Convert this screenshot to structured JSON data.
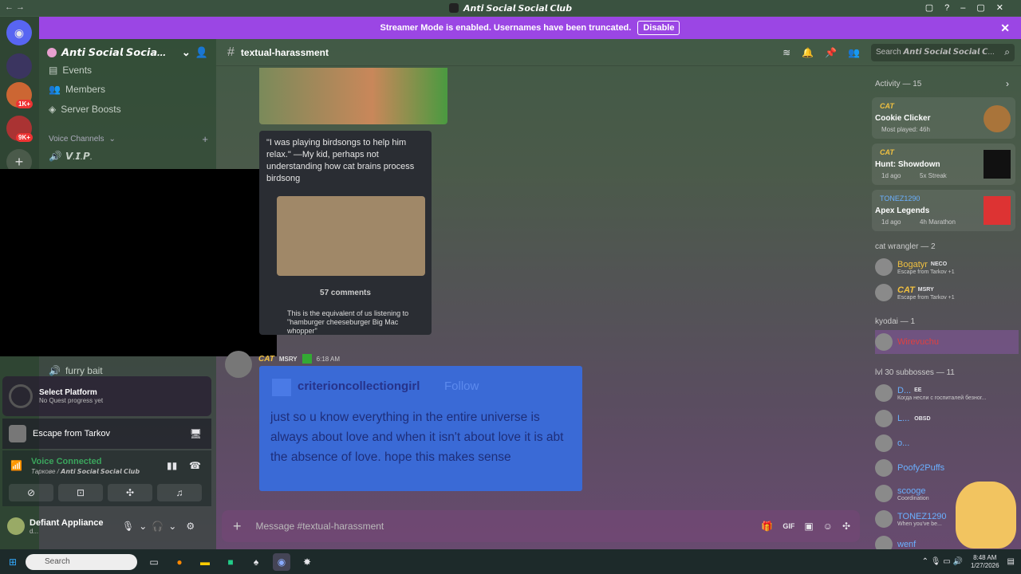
{
  "window": {
    "title": "𝘼𝙣𝙩𝙞 𝙎𝙤𝙘𝙞𝙖𝙡 𝙎𝙤𝙘𝙞𝙖𝙡 𝘾𝙡𝙪𝙗"
  },
  "banner": {
    "text": "Streamer Mode is enabled. Usernames have been truncated.",
    "button": "Disable"
  },
  "server": {
    "name": "𝘼𝙣𝙩𝙞 𝙎𝙤𝙘𝙞𝙖𝙡 𝙎𝙤𝙘𝙞𝙖..."
  },
  "sidebar": {
    "items": [
      {
        "label": "Events"
      },
      {
        "label": "Members"
      },
      {
        "label": "Server Boosts"
      }
    ],
    "voice_header": "Voice Channels",
    "vip": "𝙑.𝙄.𝙋.",
    "furry": "furry bait"
  },
  "quest": {
    "title": "Select Platform",
    "sub": "No Quest progress yet"
  },
  "activity_panel": {
    "game": "Escape from Tarkov"
  },
  "voice": {
    "status": "Voice Connected",
    "channel": "Тарковe / 𝘼𝙣𝙩𝙞 𝙎𝙤𝙘𝙞𝙖𝙡 𝙎𝙤𝙘𝙞𝙖𝙡 𝘾𝙡𝙪𝙗"
  },
  "user": {
    "name": "Defiant Appliance",
    "status": "d..."
  },
  "channel": {
    "name": "textual-harassment",
    "search_placeholder": "Search 𝘼𝙣𝙩𝙞 𝙎𝙤𝙘𝙞𝙖𝙡 𝙎𝙤𝙘𝙞𝙖𝙡 𝘾..."
  },
  "embed": {
    "quote": "\"I was playing birdsongs to help him relax.\" —My kid, perhaps not understanding how cat brains process birdsong",
    "comments": "57 comments",
    "reply": "This is the equivalent of us listening to \"hamburger cheeseburger Big Mac whopper\""
  },
  "message": {
    "author": "CAT",
    "tag": "MSRY",
    "time": "6:18 AM",
    "post_user": "criterioncollectiongirl",
    "follow": "Follow",
    "post_text": "just so u know everything in the entire universe is always about love and when it isn't about love it is abt the absence of love. hope this makes sense"
  },
  "composer": {
    "placeholder": "Message #textual-harassment"
  },
  "activity": {
    "header": "Activity — 15",
    "cards": [
      {
        "user": "CAT",
        "game": "Cookie Clicker",
        "detail": "Most played: 46h"
      },
      {
        "user": "CAT",
        "game": "Hunt: Showdown",
        "detail": "1d ago",
        "detail2": "5x Streak"
      },
      {
        "user": "TONEZ1290",
        "game": "Apex Legends",
        "detail": "1d ago",
        "detail2": "4h Marathon"
      }
    ]
  },
  "groups": [
    {
      "header": "cat wrangler — 2",
      "members": [
        {
          "name": "Bogatyr",
          "tag": "NECO",
          "status": "Escape from Tarkov +1",
          "color": "#f0c040"
        },
        {
          "name": "CAT",
          "tag": "MSRY",
          "status": "Escape from Tarkov +1",
          "color": "#f0c040"
        }
      ]
    },
    {
      "header": "kyodai — 1",
      "members": [
        {
          "name": "Wirevuchu",
          "tag": "",
          "status": "",
          "color": "#e04040"
        }
      ]
    },
    {
      "header": "lvl 30 subbosses — 11",
      "members": [
        {
          "name": "D...",
          "tag": "EE",
          "status": "Когда несли с госпиталей безног...",
          "color": "#6ab0ff"
        },
        {
          "name": "L...",
          "tag": "OBSD",
          "status": "",
          "color": "#6ab0ff"
        },
        {
          "name": "o...",
          "tag": "",
          "status": "",
          "color": "#6ab0ff"
        },
        {
          "name": "Poofy2Puffs",
          "tag": "",
          "status": "",
          "color": "#6ab0ff"
        },
        {
          "name": "scooge",
          "tag": "",
          "status": "Coordination",
          "color": "#6ab0ff"
        },
        {
          "name": "TONEZ1290",
          "tag": "",
          "status": "When you've be...",
          "color": "#6ab0ff"
        },
        {
          "name": "wenf",
          "tag": "",
          "status": "",
          "color": "#6ab0ff"
        }
      ]
    }
  ],
  "taskbar": {
    "search": "Search",
    "time": "8:48 AM",
    "date": "1/27/2026"
  },
  "badges": {
    "a": "1K+",
    "b": "9K+"
  }
}
